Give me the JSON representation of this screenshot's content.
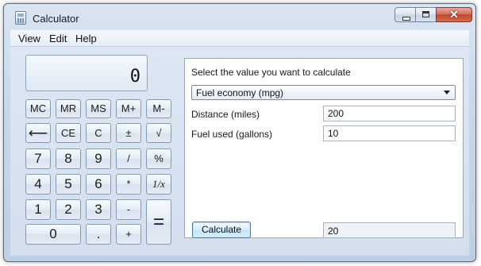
{
  "window": {
    "title": "Calculator",
    "close_glyph": "✕"
  },
  "menu": [
    "View",
    "Edit",
    "Help"
  ],
  "display": {
    "value": "0"
  },
  "keypad": {
    "mc": "MC",
    "mr": "MR",
    "ms": "MS",
    "mplus": "M+",
    "mminus": "M-",
    "backspace": "⟵",
    "ce": "CE",
    "c": "C",
    "plusminus": "±",
    "sqrt": "√",
    "d7": "7",
    "d8": "8",
    "d9": "9",
    "divide": "/",
    "percent": "%",
    "d4": "4",
    "d5": "5",
    "d6": "6",
    "multiply": "*",
    "reciprocal": "1/x",
    "d1": "1",
    "d2": "2",
    "d3": "3",
    "minus": "-",
    "equals": "=",
    "d0": "0",
    "dot": ".",
    "plus": "+"
  },
  "panel": {
    "heading": "Select the value you want to calculate",
    "selected_option": "Fuel economy (mpg)",
    "fields": [
      {
        "label": "Distance (miles)",
        "value": "200"
      },
      {
        "label": "Fuel used (gallons)",
        "value": "10"
      }
    ],
    "calculate_label": "Calculate",
    "result": "20"
  },
  "icons": {
    "app": "calculator-icon",
    "minimize": "minimize-icon",
    "maximize": "maximize-icon",
    "close": "close-icon",
    "dropdown": "chevron-down-icon"
  }
}
